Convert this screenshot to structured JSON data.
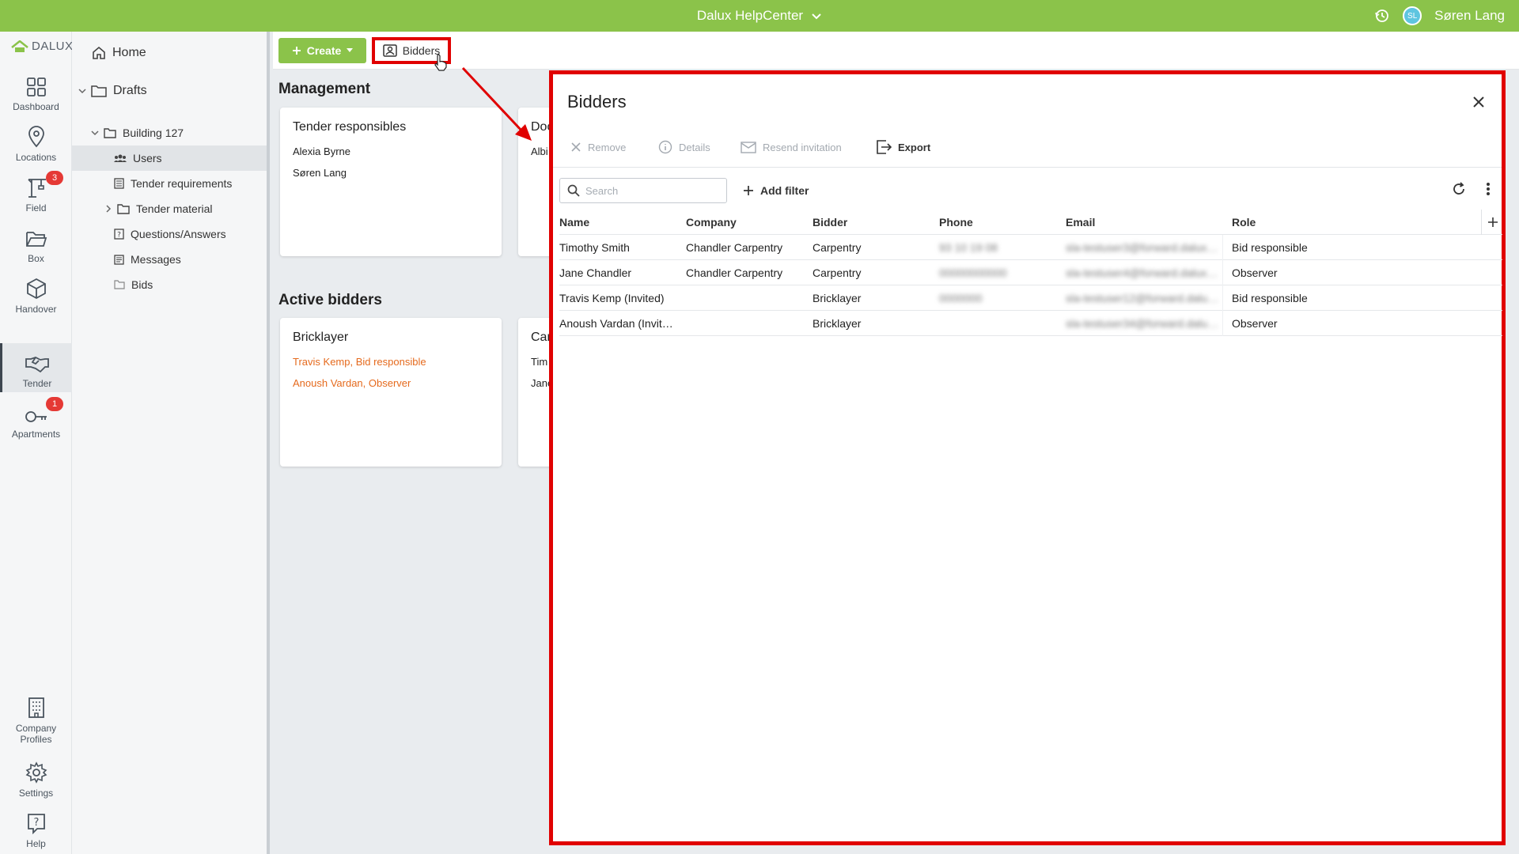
{
  "topbar": {
    "project": "Dalux HelpCenter",
    "user_initials": "SL",
    "user_name": "Søren Lang"
  },
  "rail": {
    "logo": "DALUX",
    "items": [
      {
        "label": "Dashboard",
        "icon": "dashboard-icon"
      },
      {
        "label": "Locations",
        "icon": "location-pin-icon"
      },
      {
        "label": "Field",
        "icon": "crane-icon",
        "badge": "3"
      },
      {
        "label": "Box",
        "icon": "folder-open-icon"
      },
      {
        "label": "Handover",
        "icon": "cube-icon"
      },
      {
        "label": "Tender",
        "icon": "handshake-icon"
      },
      {
        "label": "Apartments",
        "icon": "key-icon",
        "badge": "1"
      }
    ],
    "bottom": [
      {
        "label": "Company Profiles",
        "icon": "building-icon"
      },
      {
        "label": "Settings",
        "icon": "gear-icon"
      },
      {
        "label": "Help",
        "icon": "help-icon"
      }
    ]
  },
  "tree": {
    "home": "Home",
    "drafts": "Drafts",
    "building": "Building 127",
    "users": "Users",
    "tender_requirements": "Tender requirements",
    "tender_material": "Tender material",
    "qa": "Questions/Answers",
    "messages": "Messages",
    "bids": "Bids"
  },
  "toolbar": {
    "create_label": "Create",
    "bidders_label": "Bidders"
  },
  "management": {
    "title": "Management",
    "card1": {
      "title": "Tender responsibles",
      "lines": [
        "Alexia Byrne",
        "Søren Lang"
      ]
    },
    "card2": {
      "title": "Doc",
      "lines": [
        "Albi"
      ]
    }
  },
  "active_bidders": {
    "title": "Active bidders",
    "card1": {
      "title": "Bricklayer",
      "lines": [
        "Travis Kemp, Bid responsible",
        "Anoush Vardan, Observer"
      ]
    },
    "card2": {
      "title": "Car",
      "lines": [
        "Tim",
        "Jane"
      ]
    }
  },
  "modal": {
    "title": "Bidders",
    "actions": {
      "remove": "Remove",
      "details": "Details",
      "resend": "Resend invitation",
      "export": "Export"
    },
    "search_placeholder": "Search",
    "add_filter": "Add filter",
    "columns": [
      "Name",
      "Company",
      "Bidder",
      "Phone",
      "Email",
      "Role"
    ],
    "rows": [
      {
        "name": "Timothy Smith",
        "company": "Chandler Carpentry",
        "bidder": "Carpentry",
        "phone": "93 10 19 08",
        "email": "sla-testuser3@forward.dalux.com",
        "role": "Bid responsible"
      },
      {
        "name": "Jane Chandler",
        "company": "Chandler Carpentry",
        "bidder": "Carpentry",
        "phone": "00000000000",
        "email": "sla-testuser4@forward.dalux.com",
        "role": "Observer"
      },
      {
        "name": "Travis Kemp (Invited)",
        "company": "",
        "bidder": "Bricklayer",
        "phone": "0000000",
        "email": "sla-testuser12@forward.dalux.com",
        "role": "Bid responsible"
      },
      {
        "name": "Anoush Vardan (Invit…",
        "company": "",
        "bidder": "Bricklayer",
        "phone": "",
        "email": "sla-testuser34@forward.dalux.com",
        "role": "Observer"
      }
    ]
  },
  "colors": {
    "brand_green": "#8bc34a",
    "annotation_red": "#e00000",
    "orange_text": "#e56a1d",
    "badge_red": "#e53935"
  }
}
